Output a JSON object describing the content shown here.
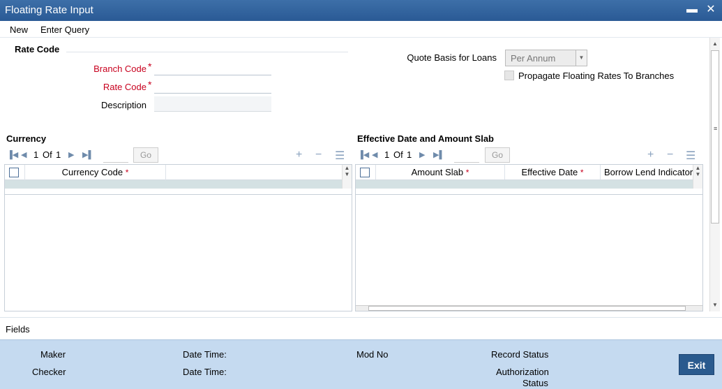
{
  "window": {
    "title": "Floating Rate Input",
    "minimize_glyph": "▬",
    "close_glyph": "✕"
  },
  "menu": {
    "new_label": "New",
    "enter_query_label": "Enter Query"
  },
  "rate_code_section": {
    "title": "Rate Code",
    "branch_code_label": "Branch Code",
    "branch_code_value": "",
    "rate_code_label": "Rate Code",
    "rate_code_value": "",
    "description_label": "Description",
    "description_value": "",
    "required_marker": "*",
    "quote_basis_label": "Quote Basis for Loans",
    "quote_basis_value": "Per Annum",
    "propagate_label": "Propagate Floating Rates To Branches",
    "propagate_checked": false
  },
  "currency_section": {
    "title": "Currency",
    "pager_current": "1",
    "pager_of": "Of",
    "pager_total": "1",
    "go_label": "Go",
    "columns": [
      "Currency Code"
    ],
    "required_marker": "*",
    "rows": []
  },
  "effective_section": {
    "title": "Effective Date and Amount Slab",
    "pager_current": "1",
    "pager_of": "Of",
    "pager_total": "1",
    "go_label": "Go",
    "columns": [
      "Amount Slab",
      "Effective Date",
      "Borrow Lend Indicator"
    ],
    "required_marker": "*",
    "rows": []
  },
  "footer": {
    "fields_label": "Fields",
    "maker_label": "Maker",
    "checker_label": "Checker",
    "date_time_label": "Date Time:",
    "mod_no_label": "Mod No",
    "record_status_label": "Record Status",
    "authorization_status_label_1": "Authorization",
    "authorization_status_label_2": "Status",
    "exit_label": "Exit"
  },
  "colors": {
    "titlebar": "#2f629c",
    "required": "#c8001e",
    "footer_bg": "#c5daf0",
    "exit_button": "#2a5a8e"
  },
  "icons": {
    "first": "first-page-icon",
    "prev": "prev-page-icon",
    "next": "next-page-icon",
    "last": "last-page-icon",
    "add": "add-row-icon",
    "delete": "delete-row-icon",
    "view": "single-view-icon"
  }
}
